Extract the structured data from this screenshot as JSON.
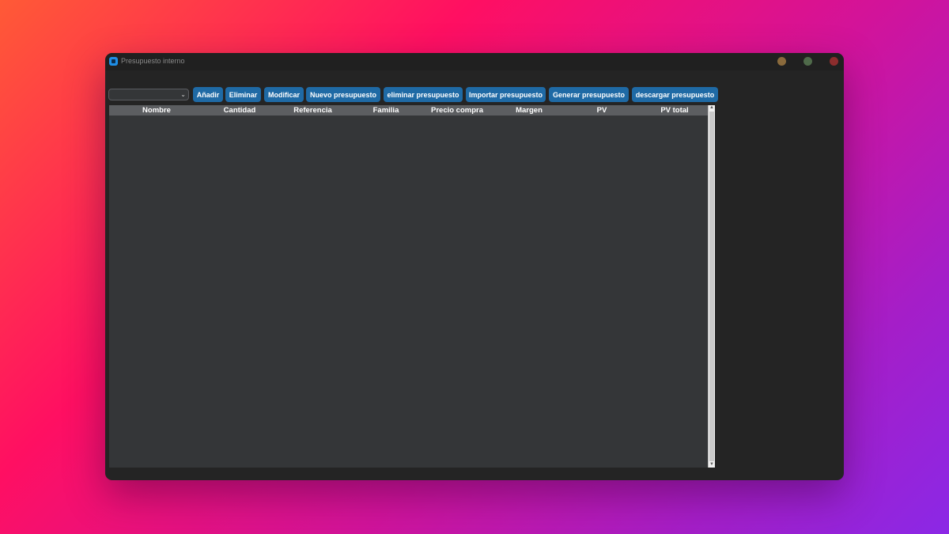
{
  "window": {
    "title": "Presupuesto interno"
  },
  "toolbar": {
    "selector_value": "",
    "buttons": [
      "Añadir",
      "Eliminar",
      "Modificar",
      "Nuevo presupuesto",
      "eliminar presupuesto",
      "Importar presupuesto",
      "Generar presupuesto",
      "descargar presupuesto"
    ]
  },
  "table": {
    "columns": [
      "Nombre",
      "Cantidad",
      "Referencia",
      "Familia",
      "Precio compra",
      "Margen",
      "PV",
      "PV total"
    ],
    "rows": []
  },
  "colors": {
    "accent": "#1f6aa5",
    "window_bg": "#242424",
    "table_bg": "#343638",
    "header_bg": "#5c5e61"
  },
  "icons": {
    "app": "app-icon",
    "dropdown": "chevron-down-icon"
  }
}
